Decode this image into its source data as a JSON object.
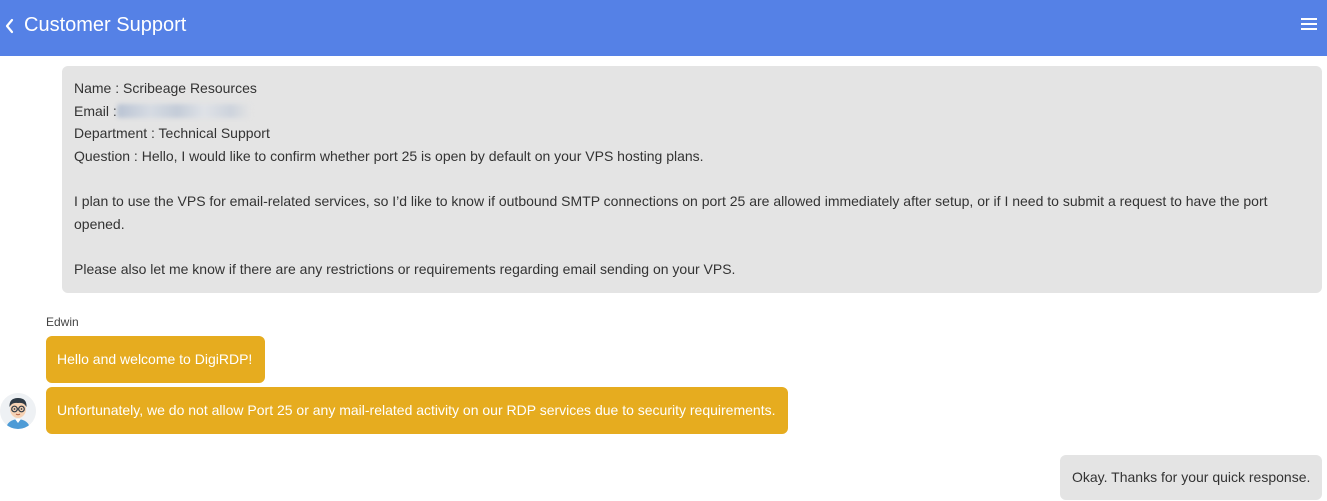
{
  "header": {
    "back_icon": "chevron-left-icon",
    "title": "Customer Support",
    "menu_icon": "hamburger-menu-icon",
    "background_color": "#5581e6"
  },
  "ticket": {
    "name_label": "Name : Scribeage Resources",
    "email_label": "Email :",
    "department_label": "Department : Technical Support",
    "question_line": "Question : Hello, I would like to confirm whether port 25 is open by default on your VPS hosting plans.",
    "paragraph_1": "I plan to use the VPS for email-related services, so I’d like to know if outbound SMTP connections on port 25 are allowed immediately after setup, or if I need to submit a request to have the port opened.",
    "paragraph_2": "Please also let me know if there are any restrictions or requirements regarding email sending on your VPS."
  },
  "agent": {
    "name": "Edwin",
    "avatar_icon": "agent-avatar-icon",
    "bubble_color": "#e6ac1f",
    "messages": [
      "Hello and welcome to DigiRDP!",
      "Unfortunately, we do not allow Port 25 or any mail-related activity on our RDP services due to security requirements."
    ]
  },
  "user_reply": {
    "text": "Okay. Thanks for your quick response."
  }
}
